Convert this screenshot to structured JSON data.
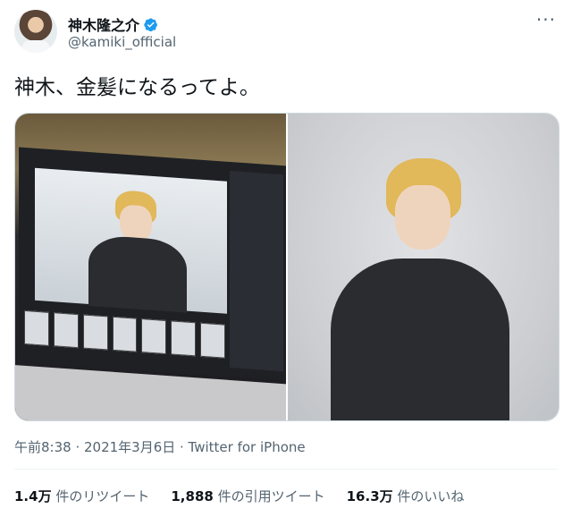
{
  "author": {
    "display_name": "神木隆之介",
    "handle": "@kamiki_official",
    "verified_icon": "verified-badge-icon",
    "avatar_icon": "avatar"
  },
  "more_menu": {
    "label": "···"
  },
  "tweet": {
    "text": "神木、金髪になるってよ。",
    "timestamp": "午前8:38 · 2021年3月6日 · Twitter for iPhone"
  },
  "media": {
    "left_alt": "laptop-photo",
    "right_alt": "portrait-photo"
  },
  "stats": [
    {
      "value": "1.4万",
      "label": "件のリツイート"
    },
    {
      "value": "1,888",
      "label": "件の引用ツイート"
    },
    {
      "value": "16.3万",
      "label": "件のいいね"
    }
  ],
  "colors": {
    "verified": "#1d9bf0",
    "secondary_text": "#536471",
    "border": "#cfd9de"
  }
}
